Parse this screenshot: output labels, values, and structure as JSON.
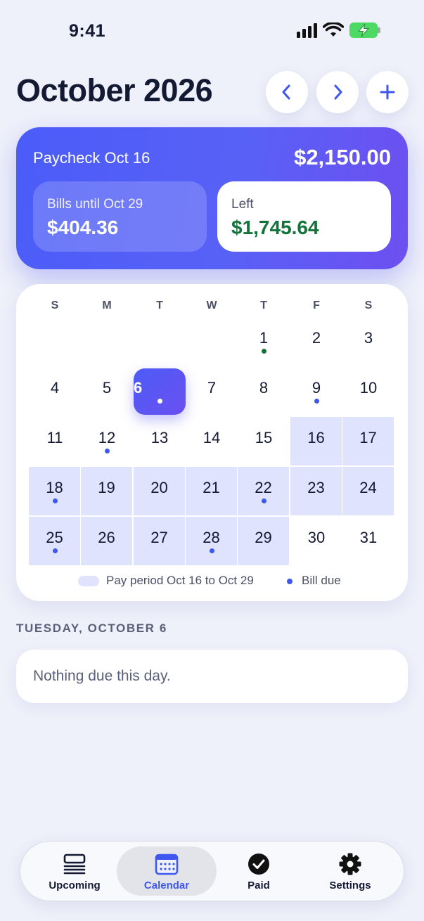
{
  "status_bar": {
    "time": "9:41"
  },
  "header": {
    "title": "October 2026"
  },
  "paycheck": {
    "label": "Paycheck Oct 16",
    "amount": "$2,150.00",
    "bills_label": "Bills until Oct 29",
    "bills_amount": "$404.36",
    "left_label": "Left",
    "left_amount": "$1,745.64"
  },
  "calendar": {
    "weekdays": [
      "S",
      "M",
      "T",
      "W",
      "T",
      "F",
      "S"
    ],
    "days": [
      {
        "n": "1",
        "dot": "green"
      },
      {
        "n": "2"
      },
      {
        "n": "3"
      },
      {
        "n": "4"
      },
      {
        "n": "5"
      },
      {
        "n": "6",
        "selected": true,
        "dot": "white"
      },
      {
        "n": "7"
      },
      {
        "n": "8"
      },
      {
        "n": "9",
        "dot": "blue"
      },
      {
        "n": "10"
      },
      {
        "n": "11"
      },
      {
        "n": "12",
        "dot": "blue"
      },
      {
        "n": "13"
      },
      {
        "n": "14"
      },
      {
        "n": "15"
      },
      {
        "n": "16",
        "period": true
      },
      {
        "n": "17",
        "period": true
      },
      {
        "n": "18",
        "period": true,
        "dot": "blue"
      },
      {
        "n": "19",
        "period": true
      },
      {
        "n": "20",
        "period": true
      },
      {
        "n": "21",
        "period": true
      },
      {
        "n": "22",
        "period": true,
        "dot": "blue"
      },
      {
        "n": "23",
        "period": true
      },
      {
        "n": "24",
        "period": true
      },
      {
        "n": "25",
        "period": true,
        "dot": "blue"
      },
      {
        "n": "26",
        "period": true
      },
      {
        "n": "27",
        "period": true
      },
      {
        "n": "28",
        "period": true,
        "dot": "blue"
      },
      {
        "n": "29",
        "period": true
      },
      {
        "n": "30"
      },
      {
        "n": "31"
      }
    ],
    "legend_period": "Pay period Oct 16 to Oct 29",
    "legend_bill": "Bill due"
  },
  "selected_day": {
    "heading": "TUESDAY, OCTOBER 6",
    "empty_text": "Nothing due this day."
  },
  "tabs": [
    {
      "label": "Upcoming",
      "icon": "list-icon"
    },
    {
      "label": "Calendar",
      "icon": "calendar-icon",
      "active": true
    },
    {
      "label": "Paid",
      "icon": "checkmark-circle-icon"
    },
    {
      "label": "Settings",
      "icon": "gear-icon"
    }
  ],
  "colors": {
    "accent": "#3d57f0",
    "card_gradient_start": "#4b5cf8",
    "card_gradient_end": "#6d4ff0",
    "positive": "#14733a",
    "period_fill": "#dfe3fd",
    "bill_dot": "#3d57f0",
    "paid_dot": "#14733a"
  }
}
